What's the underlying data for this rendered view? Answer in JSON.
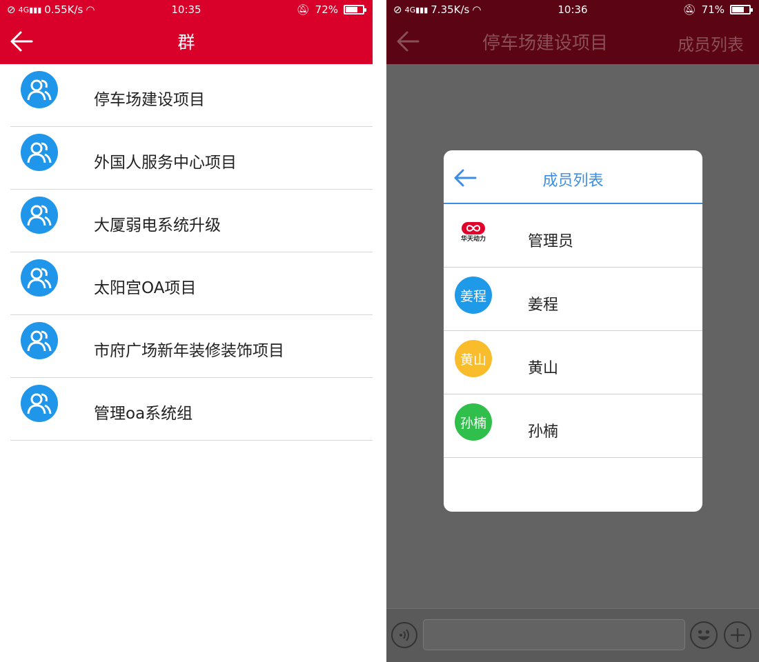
{
  "left": {
    "status": {
      "network": "0.55K/s",
      "time": "10:35",
      "battery": "72%",
      "battery_level": 0.72
    },
    "header": {
      "title": "群"
    },
    "groups": [
      {
        "name": "停车场建设项目"
      },
      {
        "name": "外国人服务中心项目"
      },
      {
        "name": "大厦弱电系统升级"
      },
      {
        "name": "太阳宫OA项目"
      },
      {
        "name": "市府广场新年装修装饰项目"
      },
      {
        "name": "管理oa系统组"
      }
    ]
  },
  "right": {
    "status": {
      "network": "7.35K/s",
      "time": "10:36",
      "battery": "71%",
      "battery_level": 0.71
    },
    "header": {
      "title": "停车场建设项目",
      "action": "成员列表"
    },
    "dialog": {
      "title": "成员列表",
      "members": [
        {
          "name": "管理员",
          "avatar_text": "",
          "logo_text": "华天动力",
          "color": "#ffffff"
        },
        {
          "name": "姜程",
          "avatar_text": "姜程",
          "color": "#1e9ae8"
        },
        {
          "name": "黄山",
          "avatar_text": "黄山",
          "color": "#f9bd2c"
        },
        {
          "name": "孙楠",
          "avatar_text": "孙楠",
          "color": "#2fbf4a"
        }
      ]
    }
  },
  "colors": {
    "brand_red": "#d9002a",
    "dialog_accent": "#3b8de6",
    "group_icon": "#1f96ea"
  }
}
